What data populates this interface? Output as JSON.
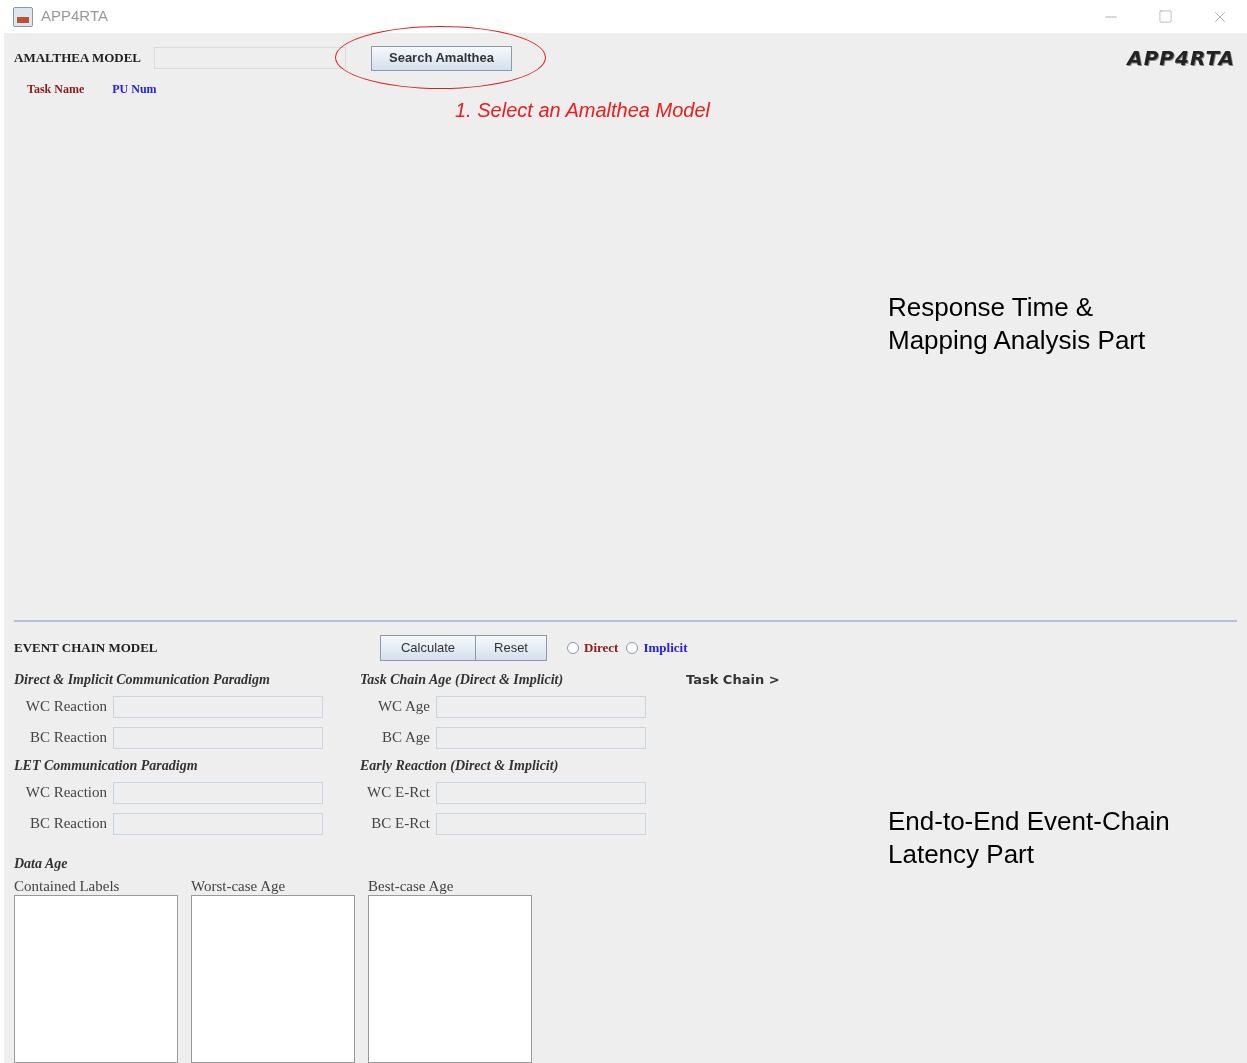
{
  "window": {
    "title": "APP4RTA"
  },
  "model": {
    "label": "AMALTHEA MODEL",
    "search_button": "Search Amalthea",
    "logo": "APP4RTA",
    "annotation": "1. Select an Amalthea Model",
    "columns": [
      {
        "label": "Task Name",
        "color": "#8b1a1a"
      },
      {
        "label": "PU Num",
        "color": "#2222ee"
      }
    ],
    "part_label": "Response Time &\nMapping Analysis Part"
  },
  "event_chain": {
    "label": "EVENT CHAIN MODEL",
    "buttons": [
      "Calculate",
      "Reset"
    ],
    "modes": [
      {
        "label": "Direct",
        "color": "#8b1a1a",
        "selected": false
      },
      {
        "label": "Implicit",
        "color": "#2222ee",
        "selected": false
      }
    ],
    "groups": [
      {
        "title": "Direct & Implicit Communication Paradigm",
        "fields": [
          "WC Reaction",
          "BC Reaction"
        ]
      },
      {
        "title": "Task Chain Age (Direct & Implicit)",
        "fields": [
          "WC Age",
          "BC Age"
        ]
      },
      {
        "title": "LET Communication Paradigm",
        "fields": [
          "WC Reaction",
          "BC Reaction"
        ]
      },
      {
        "title": "Early Reaction (Direct & Implicit)",
        "fields": [
          "WC E-Rct",
          "BC E-Rct"
        ]
      }
    ],
    "task_chain": "Task Chain >",
    "data_age": {
      "title": "Data Age",
      "lists": [
        "Contained Labels",
        "Worst-case Age",
        "Best-case Age"
      ]
    },
    "part_label": "End-to-End Event-Chain\nLatency Part"
  }
}
